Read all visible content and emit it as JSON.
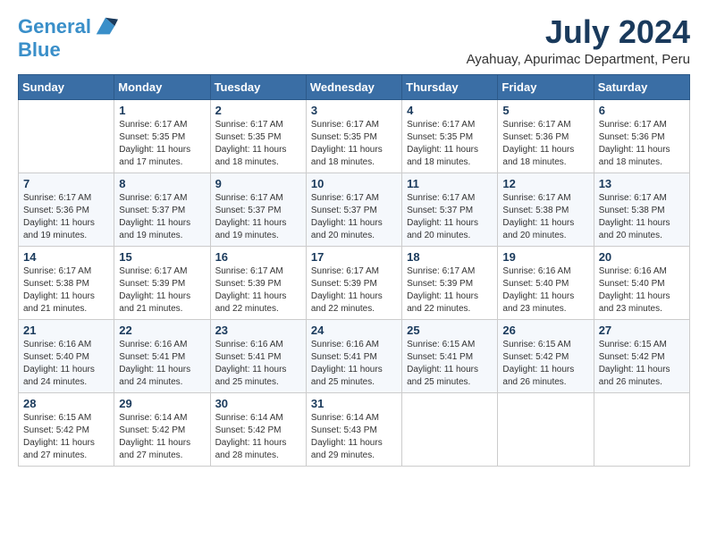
{
  "logo": {
    "line1": "General",
    "line2": "Blue"
  },
  "header": {
    "month_year": "July 2024",
    "location": "Ayahuay, Apurimac Department, Peru"
  },
  "weekdays": [
    "Sunday",
    "Monday",
    "Tuesday",
    "Wednesday",
    "Thursday",
    "Friday",
    "Saturday"
  ],
  "weeks": [
    [
      {
        "day": "",
        "sunrise": "",
        "sunset": "",
        "daylight": ""
      },
      {
        "day": "1",
        "sunrise": "Sunrise: 6:17 AM",
        "sunset": "Sunset: 5:35 PM",
        "daylight": "Daylight: 11 hours and 17 minutes."
      },
      {
        "day": "2",
        "sunrise": "Sunrise: 6:17 AM",
        "sunset": "Sunset: 5:35 PM",
        "daylight": "Daylight: 11 hours and 18 minutes."
      },
      {
        "day": "3",
        "sunrise": "Sunrise: 6:17 AM",
        "sunset": "Sunset: 5:35 PM",
        "daylight": "Daylight: 11 hours and 18 minutes."
      },
      {
        "day": "4",
        "sunrise": "Sunrise: 6:17 AM",
        "sunset": "Sunset: 5:35 PM",
        "daylight": "Daylight: 11 hours and 18 minutes."
      },
      {
        "day": "5",
        "sunrise": "Sunrise: 6:17 AM",
        "sunset": "Sunset: 5:36 PM",
        "daylight": "Daylight: 11 hours and 18 minutes."
      },
      {
        "day": "6",
        "sunrise": "Sunrise: 6:17 AM",
        "sunset": "Sunset: 5:36 PM",
        "daylight": "Daylight: 11 hours and 18 minutes."
      }
    ],
    [
      {
        "day": "7",
        "sunrise": "Sunrise: 6:17 AM",
        "sunset": "Sunset: 5:36 PM",
        "daylight": "Daylight: 11 hours and 19 minutes."
      },
      {
        "day": "8",
        "sunrise": "Sunrise: 6:17 AM",
        "sunset": "Sunset: 5:37 PM",
        "daylight": "Daylight: 11 hours and 19 minutes."
      },
      {
        "day": "9",
        "sunrise": "Sunrise: 6:17 AM",
        "sunset": "Sunset: 5:37 PM",
        "daylight": "Daylight: 11 hours and 19 minutes."
      },
      {
        "day": "10",
        "sunrise": "Sunrise: 6:17 AM",
        "sunset": "Sunset: 5:37 PM",
        "daylight": "Daylight: 11 hours and 20 minutes."
      },
      {
        "day": "11",
        "sunrise": "Sunrise: 6:17 AM",
        "sunset": "Sunset: 5:37 PM",
        "daylight": "Daylight: 11 hours and 20 minutes."
      },
      {
        "day": "12",
        "sunrise": "Sunrise: 6:17 AM",
        "sunset": "Sunset: 5:38 PM",
        "daylight": "Daylight: 11 hours and 20 minutes."
      },
      {
        "day": "13",
        "sunrise": "Sunrise: 6:17 AM",
        "sunset": "Sunset: 5:38 PM",
        "daylight": "Daylight: 11 hours and 20 minutes."
      }
    ],
    [
      {
        "day": "14",
        "sunrise": "Sunrise: 6:17 AM",
        "sunset": "Sunset: 5:38 PM",
        "daylight": "Daylight: 11 hours and 21 minutes."
      },
      {
        "day": "15",
        "sunrise": "Sunrise: 6:17 AM",
        "sunset": "Sunset: 5:39 PM",
        "daylight": "Daylight: 11 hours and 21 minutes."
      },
      {
        "day": "16",
        "sunrise": "Sunrise: 6:17 AM",
        "sunset": "Sunset: 5:39 PM",
        "daylight": "Daylight: 11 hours and 22 minutes."
      },
      {
        "day": "17",
        "sunrise": "Sunrise: 6:17 AM",
        "sunset": "Sunset: 5:39 PM",
        "daylight": "Daylight: 11 hours and 22 minutes."
      },
      {
        "day": "18",
        "sunrise": "Sunrise: 6:17 AM",
        "sunset": "Sunset: 5:39 PM",
        "daylight": "Daylight: 11 hours and 22 minutes."
      },
      {
        "day": "19",
        "sunrise": "Sunrise: 6:16 AM",
        "sunset": "Sunset: 5:40 PM",
        "daylight": "Daylight: 11 hours and 23 minutes."
      },
      {
        "day": "20",
        "sunrise": "Sunrise: 6:16 AM",
        "sunset": "Sunset: 5:40 PM",
        "daylight": "Daylight: 11 hours and 23 minutes."
      }
    ],
    [
      {
        "day": "21",
        "sunrise": "Sunrise: 6:16 AM",
        "sunset": "Sunset: 5:40 PM",
        "daylight": "Daylight: 11 hours and 24 minutes."
      },
      {
        "day": "22",
        "sunrise": "Sunrise: 6:16 AM",
        "sunset": "Sunset: 5:41 PM",
        "daylight": "Daylight: 11 hours and 24 minutes."
      },
      {
        "day": "23",
        "sunrise": "Sunrise: 6:16 AM",
        "sunset": "Sunset: 5:41 PM",
        "daylight": "Daylight: 11 hours and 25 minutes."
      },
      {
        "day": "24",
        "sunrise": "Sunrise: 6:16 AM",
        "sunset": "Sunset: 5:41 PM",
        "daylight": "Daylight: 11 hours and 25 minutes."
      },
      {
        "day": "25",
        "sunrise": "Sunrise: 6:15 AM",
        "sunset": "Sunset: 5:41 PM",
        "daylight": "Daylight: 11 hours and 25 minutes."
      },
      {
        "day": "26",
        "sunrise": "Sunrise: 6:15 AM",
        "sunset": "Sunset: 5:42 PM",
        "daylight": "Daylight: 11 hours and 26 minutes."
      },
      {
        "day": "27",
        "sunrise": "Sunrise: 6:15 AM",
        "sunset": "Sunset: 5:42 PM",
        "daylight": "Daylight: 11 hours and 26 minutes."
      }
    ],
    [
      {
        "day": "28",
        "sunrise": "Sunrise: 6:15 AM",
        "sunset": "Sunset: 5:42 PM",
        "daylight": "Daylight: 11 hours and 27 minutes."
      },
      {
        "day": "29",
        "sunrise": "Sunrise: 6:14 AM",
        "sunset": "Sunset: 5:42 PM",
        "daylight": "Daylight: 11 hours and 27 minutes."
      },
      {
        "day": "30",
        "sunrise": "Sunrise: 6:14 AM",
        "sunset": "Sunset: 5:42 PM",
        "daylight": "Daylight: 11 hours and 28 minutes."
      },
      {
        "day": "31",
        "sunrise": "Sunrise: 6:14 AM",
        "sunset": "Sunset: 5:43 PM",
        "daylight": "Daylight: 11 hours and 29 minutes."
      },
      {
        "day": "",
        "sunrise": "",
        "sunset": "",
        "daylight": ""
      },
      {
        "day": "",
        "sunrise": "",
        "sunset": "",
        "daylight": ""
      },
      {
        "day": "",
        "sunrise": "",
        "sunset": "",
        "daylight": ""
      }
    ]
  ]
}
